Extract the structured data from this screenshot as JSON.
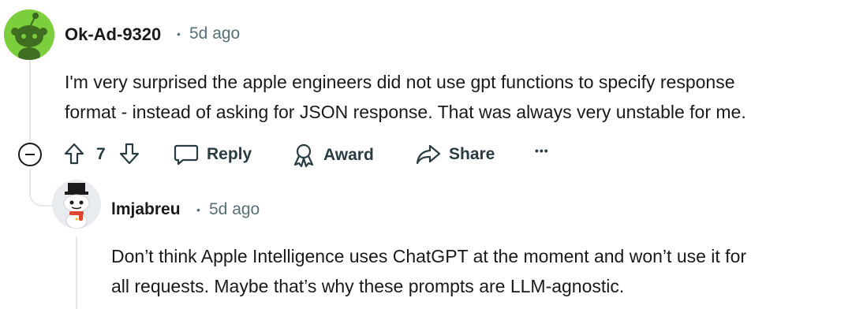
{
  "comments": [
    {
      "username": "Ok-Ad-9320",
      "separator": "•",
      "time": "5d ago",
      "avatar_icon": "snoo-avatar-green",
      "avatar_color": "#7ccf3c",
      "text": "I'm very surprised the apple engineers did not use gpt functions to specify response\nformat - instead of asking for JSON response. That was always very unstable for me.",
      "actions": {
        "votes": "7",
        "reply": "Reply",
        "award": "Award",
        "share": "Share",
        "more": "•••"
      }
    },
    {
      "username": "lmjabreu",
      "separator": "•",
      "time": "5d ago",
      "avatar_icon": "snoo-avatar-tophat",
      "text": "Don’t think Apple Intelligence uses ChatGPT at the moment and won’t use it for\nall requests. Maybe that’s why these prompts are LLM-agnostic."
    }
  ],
  "colors": {
    "text": "#1a1a1b",
    "meta": "#576f76",
    "line": "#e5e7eb"
  }
}
